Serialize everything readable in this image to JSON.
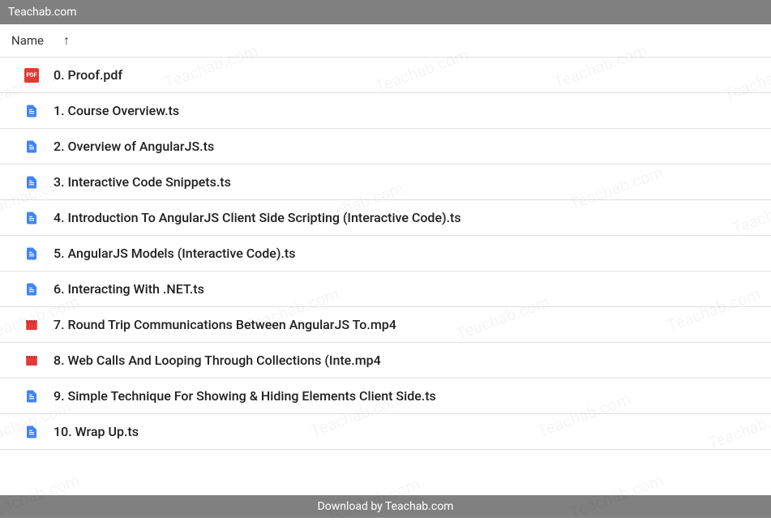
{
  "topBar": {
    "title": "Teachab.com"
  },
  "header": {
    "nameColumn": "Name",
    "sortIndicator": "↑"
  },
  "files": [
    {
      "type": "pdf",
      "name": "0. Proof.pdf"
    },
    {
      "type": "doc",
      "name": "1. Course Overview.ts"
    },
    {
      "type": "doc",
      "name": "2. Overview of AngularJS.ts"
    },
    {
      "type": "doc",
      "name": "3. Interactive Code Snippets.ts"
    },
    {
      "type": "doc",
      "name": "4. Introduction To AngularJS Client Side Scripting (Interactive Code).ts"
    },
    {
      "type": "doc",
      "name": "5. AngularJS Models (Interactive Code).ts"
    },
    {
      "type": "doc",
      "name": "6. Interacting With .NET.ts"
    },
    {
      "type": "video",
      "name": "7. Round Trip Communications Between AngularJS To.mp4"
    },
    {
      "type": "video",
      "name": "8. Web Calls And Looping Through Collections (Inte.mp4"
    },
    {
      "type": "doc",
      "name": "9. Simple Technique For Showing & Hiding Elements Client Side.ts"
    },
    {
      "type": "doc",
      "name": "10. Wrap Up.ts"
    }
  ],
  "bottomBar": {
    "text": "Download by Teachab.com"
  },
  "watermarkText": "Teachab.com",
  "iconLabels": {
    "pdf": "PDF"
  }
}
